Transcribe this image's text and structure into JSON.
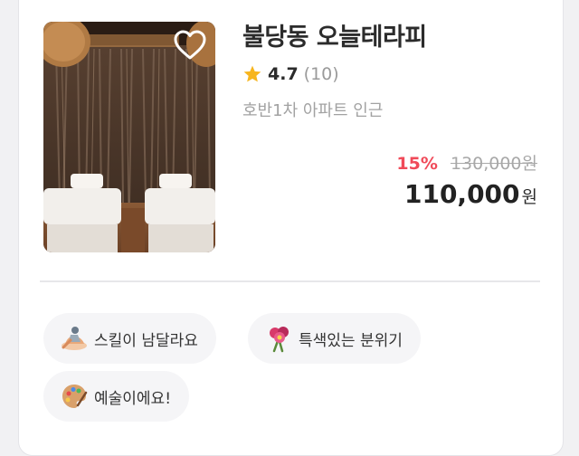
{
  "shop": {
    "name": "불당동 오늘테라피",
    "rating": "4.7",
    "review_count": "(10)",
    "location": "호반1차 아파트 인근",
    "thumbnail_alt": "spa room with two massage beds",
    "favorite_icon": "heart-outline-icon",
    "rating_icon": "star-icon"
  },
  "price": {
    "discount_rate": "15%",
    "original": "130,000원",
    "final": "110,000",
    "currency": "원"
  },
  "tags": [
    {
      "label": "스킬이 남달라요",
      "icon": "massage-hand-icon"
    },
    {
      "label": "특색있는 분위기",
      "icon": "flower-bouquet-icon"
    },
    {
      "label": "예술이에요!",
      "icon": "artist-palette-icon"
    }
  ],
  "colors": {
    "discount": "#f04a59",
    "star": "#f7b51e",
    "tag_background": "#f5f5f7"
  }
}
